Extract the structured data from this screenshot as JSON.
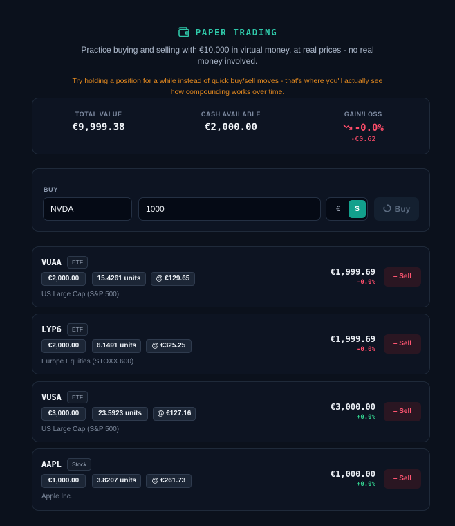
{
  "header": {
    "title": "PAPER TRADING",
    "subtitle": "Practice buying and selling with €10,000 in virtual money, at real prices - no real money involved.",
    "tip": "Try holding a position for a while instead of quick buy/sell moves - that's where you'll actually see how compounding works over time.",
    "icon": "wallet-icon"
  },
  "stats": {
    "total_value_label": "TOTAL VALUE",
    "total_value": "€9,999.38",
    "cash_label": "CASH AVAILABLE",
    "cash": "€2,000.00",
    "gain_label": "GAIN/LOSS",
    "gain_pct": "-0.0%",
    "gain_abs": "-€0.62",
    "gain_icon": "trending-down-icon"
  },
  "buy": {
    "label": "BUY",
    "ticker_value": "NVDA",
    "amount_value": "1000",
    "currency_eur": "€",
    "currency_usd": "$",
    "selected_currency": "$",
    "button_label": "Buy"
  },
  "positions": [
    {
      "ticker": "VUAA",
      "type": "ETF",
      "invested": "€2,000.00",
      "units": "15.4261 units",
      "price": "@ €129.65",
      "desc": "US Large Cap (S&P 500)",
      "value": "€1,999.69",
      "change": "-0.0%",
      "sell": "Sell"
    },
    {
      "ticker": "LYP6",
      "type": "ETF",
      "invested": "€2,000.00",
      "units": "6.1491 units",
      "price": "@ €325.25",
      "desc": "Europe Equities (STOXX 600)",
      "value": "€1,999.69",
      "change": "-0.0%",
      "sell": "Sell"
    },
    {
      "ticker": "VUSA",
      "type": "ETF",
      "invested": "€3,000.00",
      "units": "23.5923 units",
      "price": "@ €127.16",
      "desc": "US Large Cap (S&P 500)",
      "value": "€3,000.00",
      "change": "+0.0%",
      "sell": "Sell"
    },
    {
      "ticker": "AAPL",
      "type": "Stock",
      "invested": "€1,000.00",
      "units": "3.8207 units",
      "price": "@ €261.73",
      "desc": "Apple Inc.",
      "value": "€1,000.00",
      "change": "+0.0%",
      "sell": "Sell"
    }
  ],
  "colors": {
    "accent": "#2fc8a9",
    "warning": "#e58a1f",
    "negative": "#ff4d6a",
    "positive": "#33d08e",
    "background": "#0b111c"
  }
}
